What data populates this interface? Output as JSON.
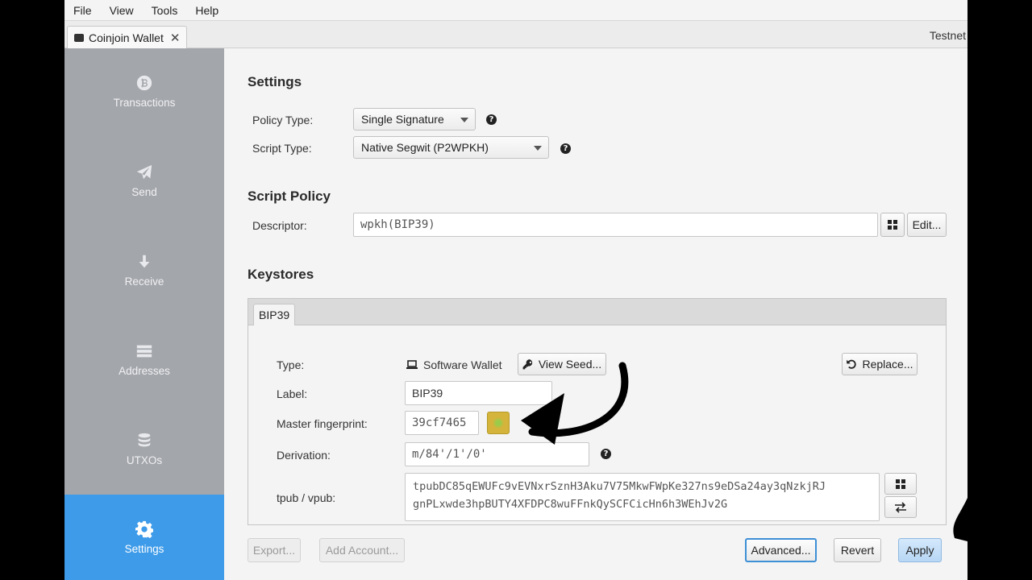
{
  "menubar": {
    "items": [
      "File",
      "View",
      "Tools",
      "Help"
    ]
  },
  "tabbar": {
    "wallet_tab": "Coinjoin Wallet",
    "close": "✕",
    "network": "Testnet"
  },
  "sidebar": {
    "items": [
      {
        "label": "Transactions",
        "icon": "bitcoin-icon"
      },
      {
        "label": "Send",
        "icon": "paper-plane-icon"
      },
      {
        "label": "Receive",
        "icon": "arrow-down-icon"
      },
      {
        "label": "Addresses",
        "icon": "list-icon"
      },
      {
        "label": "UTXOs",
        "icon": "coins-icon"
      },
      {
        "label": "Settings",
        "icon": "gear-icon",
        "active": true
      }
    ]
  },
  "settings": {
    "title": "Settings",
    "policy_type_label": "Policy Type:",
    "policy_type_value": "Single Signature",
    "script_type_label": "Script Type:",
    "script_type_value": "Native Segwit (P2WPKH)",
    "help_glyph": "?"
  },
  "script_policy": {
    "title": "Script Policy",
    "descriptor_label": "Descriptor:",
    "descriptor_value": "wpkh(BIP39)",
    "edit_button": "Edit..."
  },
  "keystores": {
    "title": "Keystores",
    "tab": "BIP39",
    "type_label": "Type:",
    "type_value": "Software Wallet",
    "view_seed_button": "View Seed...",
    "replace_button": "Replace...",
    "label_label": "Label:",
    "label_value": "BIP39",
    "fingerprint_label": "Master fingerprint:",
    "fingerprint_value": "39cf7465",
    "derivation_label": "Derivation:",
    "derivation_value": "m/84'/1'/0'",
    "xpub_label": "tpub / vpub:",
    "xpub_line1": "tpubDC85qEWUFc9vEVNxrSznH3Aku7V75MkwFWpKe327ns9eDSa24ay3qNzkjRJ",
    "xpub_line2": "gnPLxwde3hpBUTY4XFDPC8wuFFnkQySCFCicHn6h3WEhJv2G"
  },
  "footer": {
    "export_button": "Export...",
    "add_account_button": "Add Account...",
    "advanced_button": "Advanced...",
    "revert_button": "Revert",
    "apply_button": "Apply"
  },
  "colors": {
    "sidebar_bg": "#a3a6ab",
    "sidebar_active": "#3d9be9",
    "accent": "#3d8fd6"
  }
}
